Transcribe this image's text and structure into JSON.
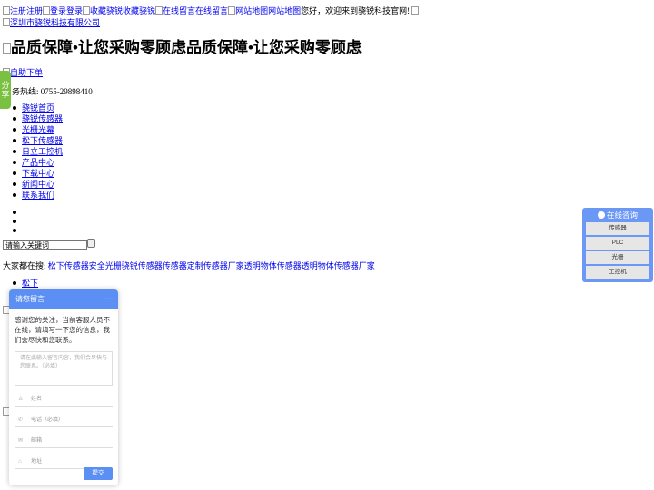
{
  "topbar": {
    "links": [
      "注册注册",
      "登录登录",
      "收藏骁锐收藏骁锐",
      "在线留言在线留言",
      "网站地图网站地图"
    ],
    "welcome": "您好，欢迎来到骁锐科技官网!",
    "company": "深圳市骁锐科技有限公司"
  },
  "banner": {
    "slogan": "品质保障•让您采购零顾虑品质保障•让您采购零顾虑"
  },
  "self_order": "自助下单",
  "hotline": {
    "label": "务热线:",
    "number": "0755-29898410"
  },
  "share": "分享",
  "nav": [
    "骁锐首页",
    "骁锐传感器",
    "光栅光幕",
    "松下传感器",
    "日立工控机",
    "产品中心",
    "下载中心",
    "新闻中心",
    "联系我们"
  ],
  "search": {
    "placeholder": "请输入关键词"
  },
  "everyone": {
    "label": "大家都在搜:",
    "links": "松下传感器安全光栅骁锐传感器传感器定制传感器厂家透明物体传感器透明物体传感器厂家"
  },
  "subnav": [
    "松下"
  ],
  "message_panel": {
    "title": "请您留言",
    "minimize": "—",
    "intro": "感谢您的关注，当前客服人员不在线，请填写一下您的信息，我们会尽快和您联系。",
    "textarea_placeholder": "请在此输入留言内容，我们会尽快与您联系。（必填）",
    "fields": [
      "姓名",
      "电话（必填）",
      "邮箱",
      "地址"
    ],
    "submit": "提交"
  },
  "consult": {
    "title": "在线咨询",
    "items": [
      "传感器",
      "PLC",
      "光栅",
      "工控机"
    ]
  },
  "colors": {
    "link": "#0000ee",
    "share": "#7ac142",
    "panel_header": "#5b8ff3",
    "consult": "#6c98f5"
  }
}
